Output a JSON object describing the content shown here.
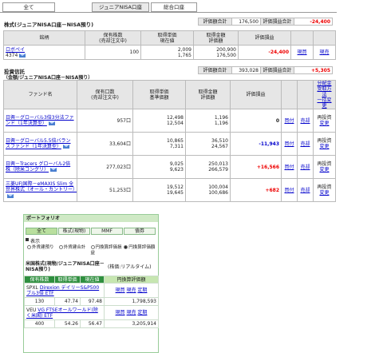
{
  "tabs": [
    "全て",
    "ジュニアNISA口座",
    "総合口座"
  ],
  "stock_section": {
    "title": "株式(ジュニアNISA口座－NISA預り)",
    "summary": {
      "eval_total_label": "評価額合計",
      "eval_total": "176,500",
      "pl_total_label": "評価損益合計",
      "pl_total": "-24,400"
    },
    "headers": [
      "銘柄",
      "保有株数\n(売却注文中)",
      "取得単価\n現在値",
      "取得金額\n評価額",
      "評価損益"
    ],
    "rows": [
      {
        "name": "ロボペイ",
        "code": "4374",
        "shares": "100",
        "cost": "2,009",
        "price": "1,765",
        "cost_amt": "200,900",
        "eval_amt": "176,500",
        "pl": "-24,400",
        "act1": "現買",
        "act2": "現売"
      }
    ]
  },
  "fund_section": {
    "title": "投資信託",
    "subtitle": "（金額/ジュニアNISA口座－NISA預り）",
    "summary": {
      "eval_total_label": "評価額合計",
      "eval_total": "393,028",
      "pl_total_label": "評価損益合計",
      "pl_total": "+5,305"
    },
    "headers": [
      "ファンド名",
      "保有口数\n(売却注文中)",
      "取得単価\n基準価額",
      "取得金額\n評価額",
      "評価損益",
      "",
      "",
      "分配金\n受取方法\n一括変更"
    ],
    "rows": [
      {
        "name": "日興－グローバル3倍3分法ファンド（1年決算型）",
        "units": "957口",
        "cost": "12,498",
        "nav": "12,504",
        "cost_amt": "1,196",
        "eval_amt": "1,196",
        "pl": "0",
        "act1": "買付",
        "act2": "売却",
        "dist": "再投資",
        "change": "変更"
      },
      {
        "name": "日興－グローバル5.5倍バランスファンド（1年決算型）",
        "units": "33,604口",
        "cost": "10,865",
        "nav": "7,311",
        "cost_amt": "36,510",
        "eval_amt": "24,567",
        "pl": "-11,943",
        "act1": "買付",
        "act2": "売却",
        "dist": "再投資",
        "change": "変更"
      },
      {
        "name": "日興－Tracers グローバル2倍株（除米コングリ）",
        "units": "277,023口",
        "cost": "9,025",
        "nav": "9,623",
        "cost_amt": "250,013",
        "eval_amt": "266,579",
        "pl": "+16,566",
        "act1": "買付",
        "act2": "売却",
        "dist": "再投資",
        "change": "変更"
      },
      {
        "name": "三菱UFJ国際－eMAXIS Slim 全世界株式（オール・カントリー）",
        "units": "51,253口",
        "cost": "19,512",
        "nav": "19,645",
        "cost_amt": "100,004",
        "eval_amt": "100,686",
        "pl": "+682",
        "act1": "買付",
        "act2": "売却",
        "dist": "再投資",
        "change": "変更"
      }
    ]
  },
  "portfolio": {
    "title": "ポートフォリオ",
    "tabs": [
      "全て",
      "株式(現物)",
      "MMF",
      "債券"
    ],
    "display_label": "表示",
    "options": [
      "外貨建預り",
      "外貨建合計",
      "円換算評価損益",
      "円換算評価額"
    ],
    "us_title": "米国株式(現物/ジュニアNISA口座－NISA預り)",
    "price_note": "(株価:リアルタイム)",
    "headers": [
      "保有株数",
      "取得単価",
      "現在値",
      "円換算評価額"
    ],
    "rows": [
      {
        "ticker": "SPXL",
        "name": "Direxion デイリーS&P500ブル3倍 ETF",
        "shares": "130",
        "cost": "47.74",
        "price": "97.48",
        "yen_eval": "1,798,593",
        "act1": "現買",
        "act2": "現売",
        "act3": "定期"
      },
      {
        "ticker": "VEU",
        "name": "VG FTSEオールワールド(除く米国) ETF",
        "shares": "400",
        "cost": "54.26",
        "price": "56.47",
        "yen_eval": "3,205,914",
        "act1": "現買",
        "act2": "現売",
        "act3": "定期"
      }
    ]
  }
}
